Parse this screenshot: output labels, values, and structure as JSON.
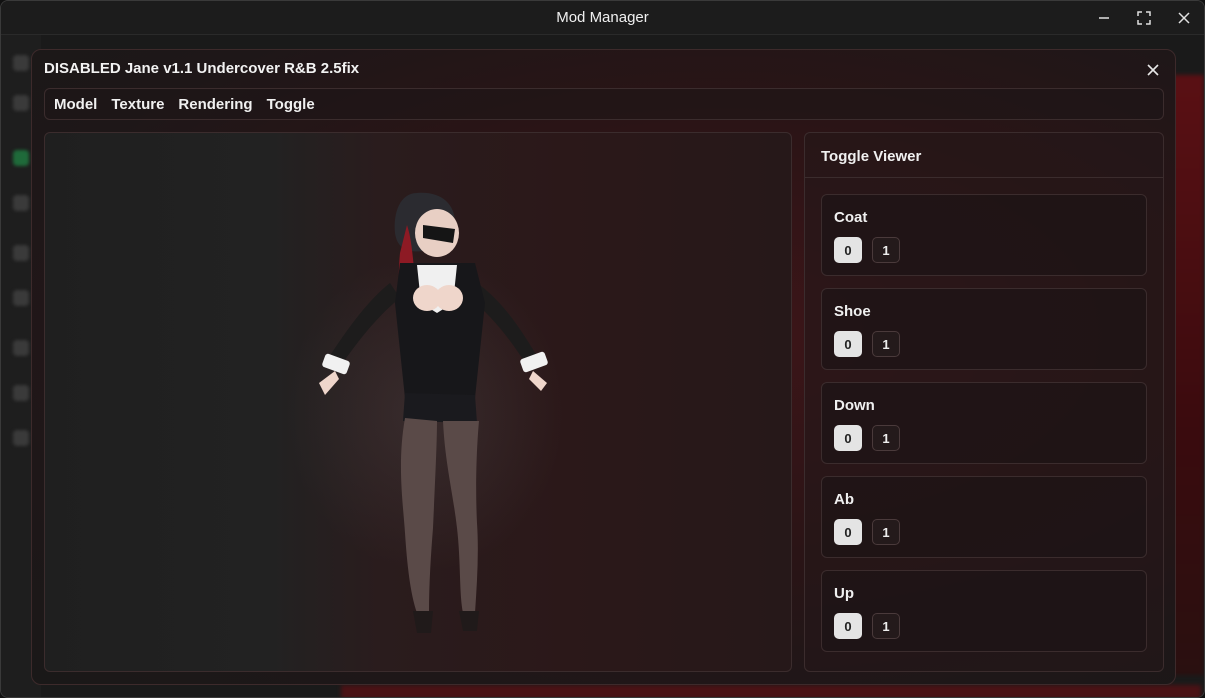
{
  "window": {
    "title": "Mod Manager"
  },
  "modal": {
    "title": "DISABLED Jane v1.1 Undercover R&B 2.5fix",
    "menu": [
      "Model",
      "Texture",
      "Rendering",
      "Toggle"
    ]
  },
  "toggle_viewer": {
    "title": "Toggle Viewer",
    "toggles": [
      {
        "name": "Coat",
        "options": [
          "0",
          "1"
        ],
        "selected": "0"
      },
      {
        "name": "Shoe",
        "options": [
          "0",
          "1"
        ],
        "selected": "0"
      },
      {
        "name": "Down",
        "options": [
          "0",
          "1"
        ],
        "selected": "0"
      },
      {
        "name": "Ab",
        "options": [
          "0",
          "1"
        ],
        "selected": "0"
      },
      {
        "name": "Up",
        "options": [
          "0",
          "1"
        ],
        "selected": "0"
      }
    ]
  },
  "colors": {
    "accent_red": "#5a1014",
    "panel_border": "#3b2c2d",
    "selected_bg": "#e4e4e4"
  }
}
